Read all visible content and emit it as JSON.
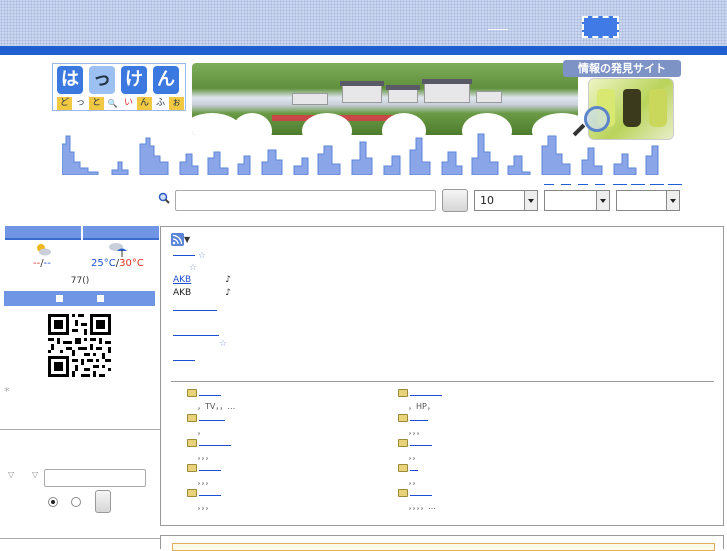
{
  "header": {
    "logo_top": [
      "は",
      "っ",
      "け",
      "ん"
    ],
    "logo_bottom": [
      "ど",
      "っ",
      "と",
      "🔍",
      "い",
      "ん",
      "ふ",
      "ぉ"
    ],
    "tagline": "情報の発見サイト"
  },
  "search": {
    "count_value": "10",
    "select2_value": "",
    "select3_value": ""
  },
  "weather": {
    "today_temp_hi": "--",
    "today_temp_lo": "--",
    "tomorrow_temp_hi": "25°C",
    "tomorrow_temp_lo": "30°C",
    "separator": "/"
  },
  "counter": "77()",
  "left": {
    "star": "*",
    "triangle1": "▽",
    "triangle2": "▽"
  },
  "news": [
    {
      "type": "link-star",
      "star": "☆"
    },
    {
      "type": "star",
      "star": "☆"
    },
    {
      "type": "link-note",
      "prefix": "AKB",
      "note": "♪"
    },
    {
      "type": "text-note",
      "prefix": "AKB",
      "note": "♪"
    },
    {
      "type": "link"
    },
    {
      "type": "link"
    },
    {
      "type": "star",
      "star": "☆"
    },
    {
      "type": "link"
    }
  ],
  "categories": [
    {
      "sub": "，TV，，…"
    },
    {
      "sub": "，HP，"
    },
    {
      "sub": "，"
    },
    {
      "sub": "，，，"
    },
    {
      "sub": "，，，"
    },
    {
      "sub": "，，"
    },
    {
      "sub": "，，，"
    },
    {
      "sub": "，，"
    },
    {
      "sub": "，，，"
    },
    {
      "sub": "，，，，…"
    }
  ],
  "colors": {
    "accent": "#1f5fd2",
    "nav_blue": "#6f95e4",
    "link": "#1f4fd1",
    "temp_hot": "#dd3322"
  },
  "icons": [
    "search-icon",
    "rss-icon",
    "folder-icon",
    "sun-cloud-icon",
    "umbrella-cloud-icon",
    "qr-code",
    "magnifier-icon"
  ]
}
